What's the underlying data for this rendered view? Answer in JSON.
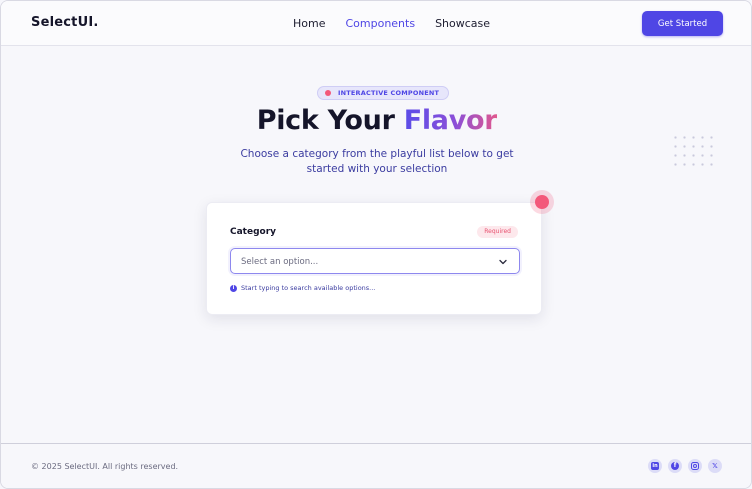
{
  "header": {
    "logo": "SelectUI.",
    "nav": [
      "Home",
      "Components",
      "Showcase"
    ],
    "active_nav": "Components",
    "cta_label": "Get Started"
  },
  "hero": {
    "badge": "INTERACTIVE COMPONENT",
    "title_plain": "Pick Your ",
    "title_accent": "Flavor",
    "subtitle": "Choose a category from the playful list below to get started with your selection"
  },
  "card": {
    "label": "Category",
    "required": "Required",
    "select_placeholder": "Select an option...",
    "hint": "Start typing to search available options..."
  },
  "footer": {
    "copyright": "© 2025 SelectUI. All rights reserved.",
    "socials": [
      "linkedin-icon",
      "facebook-icon",
      "instagram-icon",
      "x-icon"
    ]
  },
  "colors": {
    "accent": "#4f46e5",
    "pink": "#f3587a",
    "background": "#f7f7fb"
  }
}
